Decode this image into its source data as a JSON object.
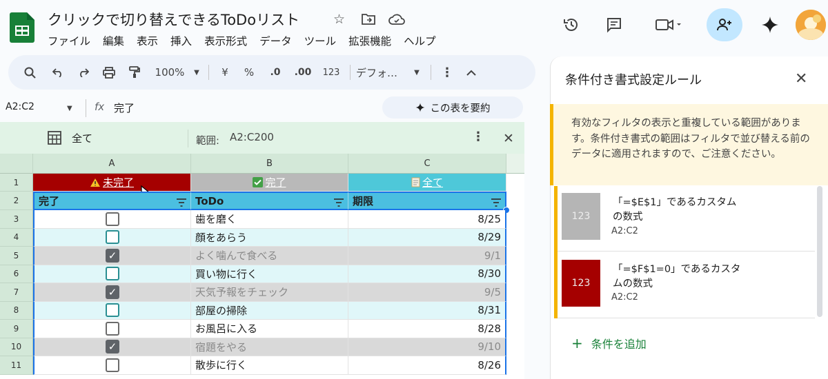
{
  "doc": {
    "title": "クリックで切り替えできるToDoリスト"
  },
  "menu": [
    "ファイル",
    "編集",
    "表示",
    "挿入",
    "表示形式",
    "データ",
    "ツール",
    "拡張機能",
    "ヘルプ"
  ],
  "toolbar": {
    "zoom": "100%",
    "currency": "¥",
    "percent": "%",
    "dec_less": ".0",
    "dec_more": ".00",
    "number_format": "123",
    "font": "デフォ…"
  },
  "formula_bar": {
    "cell_ref": "A2:C2",
    "fx": "fx",
    "value": "完了"
  },
  "summarize_label": "この表を要約",
  "filter_view": {
    "name": "全て",
    "range_label": "範囲:",
    "range": "A2:C200"
  },
  "grid": {
    "columns": [
      "A",
      "B",
      "C"
    ],
    "row1": {
      "a": "未完了",
      "b": "完了",
      "c": "全て"
    },
    "headers": {
      "a": "完了",
      "b": "ToDo",
      "c": "期限"
    },
    "rows": [
      {
        "num": "3",
        "done": false,
        "todo": "歯を磨く",
        "due": "8/25",
        "style": "white"
      },
      {
        "num": "4",
        "done": false,
        "todo": "顔をあらう",
        "due": "8/29",
        "style": "teal"
      },
      {
        "num": "5",
        "done": true,
        "todo": "よく噛んで食べる",
        "due": "9/1",
        "style": "gray"
      },
      {
        "num": "6",
        "done": false,
        "todo": "買い物に行く",
        "due": "8/30",
        "style": "teal"
      },
      {
        "num": "7",
        "done": true,
        "todo": "天気予報をチェック",
        "due": "9/5",
        "style": "gray"
      },
      {
        "num": "8",
        "done": false,
        "todo": "部屋の掃除",
        "due": "8/31",
        "style": "teal"
      },
      {
        "num": "9",
        "done": false,
        "todo": "お風呂に入る",
        "due": "8/28",
        "style": "white"
      },
      {
        "num": "10",
        "done": true,
        "todo": "宿題をやる",
        "due": "9/10",
        "style": "gray"
      },
      {
        "num": "11",
        "done": false,
        "todo": "散歩に行く",
        "due": "8/26",
        "style": "white"
      }
    ],
    "row_nums": {
      "r1": "1",
      "r2": "2"
    }
  },
  "panel": {
    "title": "条件付き書式設定ルール",
    "warning": "有効なフィルタの表示と重複している範囲があります。条件付き書式の範囲はフィルタで並び替える前のデータに適用されますので、ご注意ください。",
    "rules": [
      {
        "swatch": "123",
        "name": "「=$E$1」であるカスタムの数式",
        "range": "A2:C2",
        "color": "#b5b5b5"
      },
      {
        "swatch": "123",
        "name": "「=$F$1=0」であるカスタムの数式",
        "range": "A2:C2",
        "color": "#a50000"
      }
    ],
    "add_label": "条件を追加"
  },
  "colors": {
    "accent_green": "#188038",
    "chip_red": "#a50000",
    "chip_gray": "#b9b9b9",
    "chip_teal": "#4ec8d9",
    "header_blue": "#4bbfe0",
    "row_teal": "#e0f7f9",
    "row_gray": "#d9d9d9"
  }
}
